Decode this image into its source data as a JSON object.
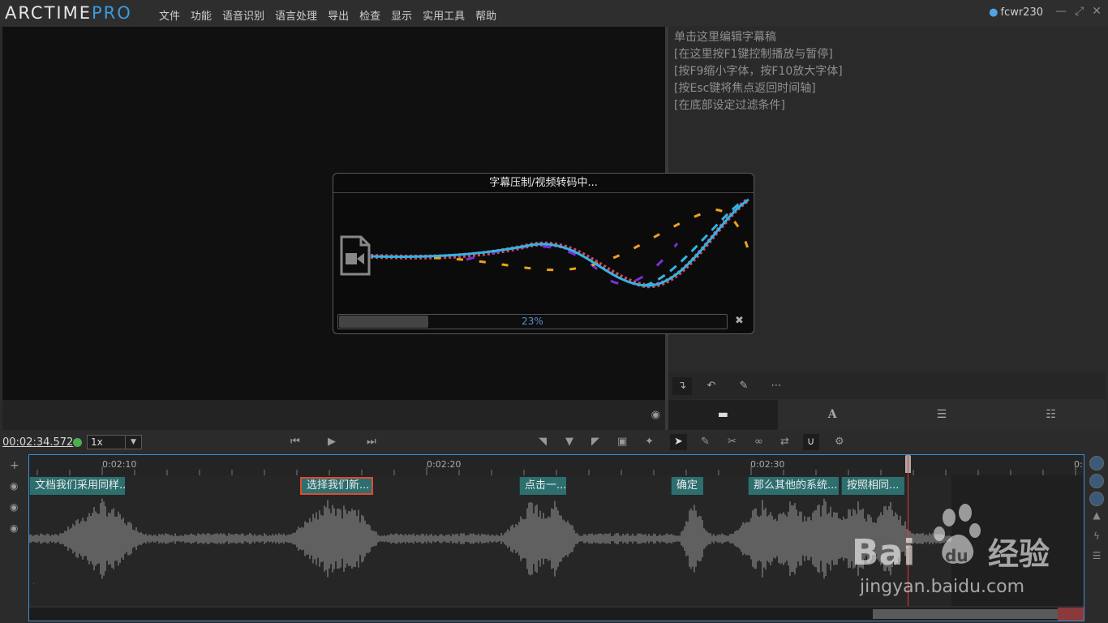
{
  "app": {
    "logo_main": "ARCTIME",
    "logo_accent": "PRO",
    "menu": [
      "文件",
      "功能",
      "语音识别",
      "语言处理",
      "导出",
      "检查",
      "显示",
      "实用工具",
      "帮助"
    ],
    "user": "fcwr230"
  },
  "script_panel": {
    "lines": [
      "单击这里编辑字幕稿",
      "[在这里按F1键控制播放与暂停]",
      "[按F9缩小字体，按F10放大字体]",
      "[按Esc键将焦点返回时间轴]",
      "[在底部设定过滤条件]"
    ]
  },
  "transport": {
    "timecode": "00:02:34.572",
    "speed": "1x"
  },
  "timeline": {
    "ruler_labels": [
      "0:02:10",
      "0:02:20",
      "0:02:30",
      "0:"
    ],
    "subtitles": [
      "文档我们采用同样...",
      "选择我们新...",
      "点击一...",
      "确定",
      "那么其他的系统...",
      "按照相同..."
    ]
  },
  "modal": {
    "title": "字幕压制/视频转码中...",
    "progress_label": "23%",
    "progress_value": 0.23
  },
  "watermark": {
    "brand": "Bai",
    "brand_paw": "du",
    "brand_cn": "经验",
    "url": "jingyan.baidu.com"
  },
  "colors": {
    "accent": "#3a9be0",
    "subtitle_block": "#2d6f6f",
    "selected_border": "#e0492e",
    "playhead": "#e23b2b",
    "status_ok": "#4caf50"
  }
}
